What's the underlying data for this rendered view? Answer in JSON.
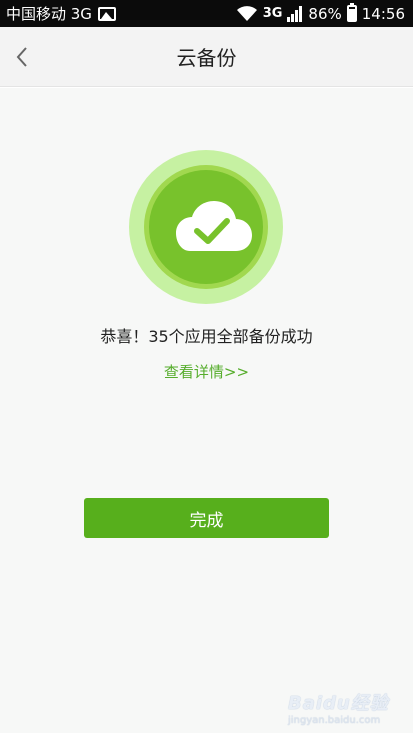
{
  "status_bar": {
    "carrier": "中国移动 3G",
    "network_badge": "3G",
    "battery": "86%",
    "time": "14:56",
    "icons": [
      "image-icon",
      "wifi-icon",
      "signal-icon",
      "battery-icon"
    ]
  },
  "nav": {
    "back_icon": "chevron-left-icon",
    "title": "云备份"
  },
  "result": {
    "icon": "cloud-check-icon",
    "message": "恭喜！35个应用全部备份成功",
    "details_link": "查看详情>>"
  },
  "actions": {
    "done_label": "完成"
  },
  "watermark": {
    "logo": "Baidu经验",
    "url": "jingyan.baidu.com"
  },
  "colors": {
    "accent": "#57af1c",
    "link": "#56ad2c",
    "ring_outer": "#c6f1a2",
    "ring_middle": "#a1d84f",
    "ring_inner": "#78c22c"
  }
}
